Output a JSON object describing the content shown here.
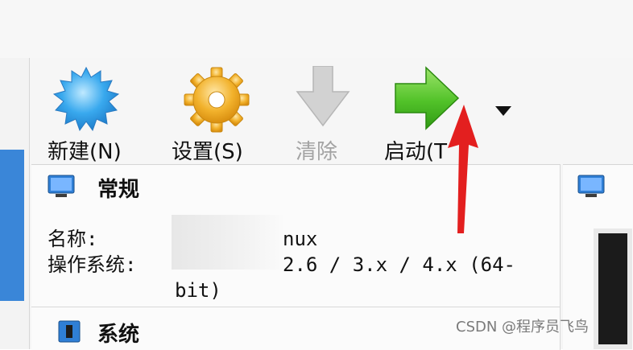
{
  "toolbar": {
    "new_label": "新建(N)",
    "settings_label": "设置(S)",
    "clear_label": "清除",
    "start_label": "启动(T"
  },
  "general": {
    "title": "常规",
    "name_label": "名称:",
    "name_value": "nux",
    "os_label": "操作系统:",
    "os_value": "2.6 / 3.x / 4.x (64-",
    "os_value_cont": "bit)"
  },
  "system": {
    "title": "系统"
  },
  "watermark": "CSDN @程序员飞鸟",
  "colors": {
    "new_icon": "#39a9ee",
    "settings_icon": "#f2b22c",
    "clear_icon": "#cfcfcf",
    "start_icon": "#52c229",
    "annotation_arrow": "#e31f1f"
  },
  "icons": {
    "new": "starburst-icon",
    "settings": "gear-icon",
    "clear": "down-arrow-icon",
    "start": "right-arrow-icon",
    "dropdown": "triangle-down-icon",
    "section": "monitor-icon",
    "system_section": "chip-icon"
  }
}
